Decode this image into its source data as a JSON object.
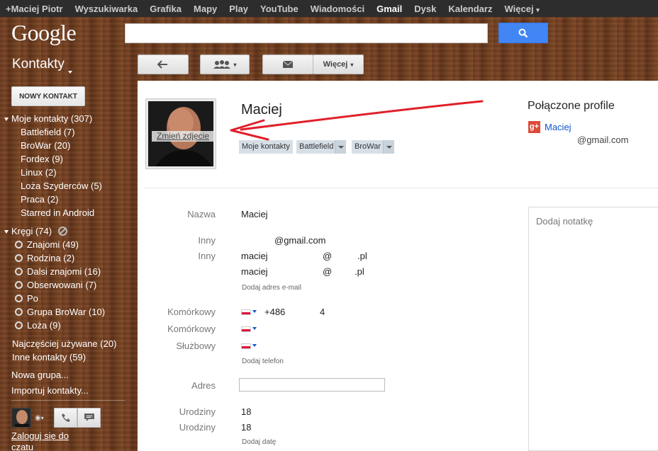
{
  "topbar": {
    "items": [
      "+Maciej Piotr",
      "Wyszukiwarka",
      "Grafika",
      "Mapy",
      "Play",
      "YouTube",
      "Wiadomości",
      "Gmail",
      "Dysk",
      "Kalendarz",
      "Więcej"
    ],
    "active": "Gmail"
  },
  "logo": "Google",
  "search": {
    "value": ""
  },
  "app_title": "Kontakty",
  "toolbar": {
    "more_label": "Więcej"
  },
  "new_contact_label": "NOWY KONTAKT",
  "sidebar": {
    "my_contacts": "Moje kontakty (307)",
    "groups": [
      "Battlefield (7)",
      "BroWar (20)",
      "Fordex (9)",
      "Linux (2)",
      "Loża Szyderców (5)",
      "Praca (2)",
      "Starred in Android"
    ],
    "circles_header": "Kręgi (74)",
    "circles": [
      "Znajomi (49)",
      "Rodzina (2)",
      "Dalsi znajomi (16)",
      "Obserwowani (7)",
      "Po",
      "Grupa BroWar (10)",
      "Loża (9)"
    ],
    "most_used": "Najczęściej używane (20)",
    "other_contacts": "Inne kontakty (59)",
    "new_group": "Nowa grupa...",
    "import": "Importuj kontakty...",
    "signin": "Zaloguj się do czatu"
  },
  "contact": {
    "name": "Maciej",
    "change_photo": "Zmień zdjęcie",
    "chips": [
      "Moje kontakty",
      "Battlefield",
      "BroWar"
    ],
    "fields": {
      "name_label": "Nazwa",
      "name_value": "Maciej",
      "other1_label": "Inny",
      "other1_value": "@gmail.com",
      "other2_label": "Inny",
      "other2_value_a": "maciej",
      "other2_value_b": "@",
      "other2_value_c": ".pl",
      "other3_value_a": "maciej",
      "other3_value_b": "@",
      "other3_value_c": ".pl",
      "add_email": "Dodaj adres e-mail",
      "mobile1_label": "Komórkowy",
      "mobile1_value_a": "+486",
      "mobile1_value_b": "4",
      "mobile2_label": "Komórkowy",
      "work_label": "Służbowy",
      "add_phone": "Dodaj telefon",
      "address_label": "Adres",
      "birthday1_label": "Urodziny",
      "birthday1_value": "18",
      "birthday2_label": "Urodziny",
      "birthday2_value": "18",
      "add_date": "Dodaj datę"
    }
  },
  "linked_profiles": {
    "title": "Połączone profile",
    "name": "Maciej",
    "email": "@gmail.com"
  },
  "note_placeholder": "Dodaj notatkę",
  "colors": {
    "topbar": "#2d2d2d",
    "search_button": "#4285f4",
    "link": "#1155cc",
    "arrow": "#e0202a"
  }
}
